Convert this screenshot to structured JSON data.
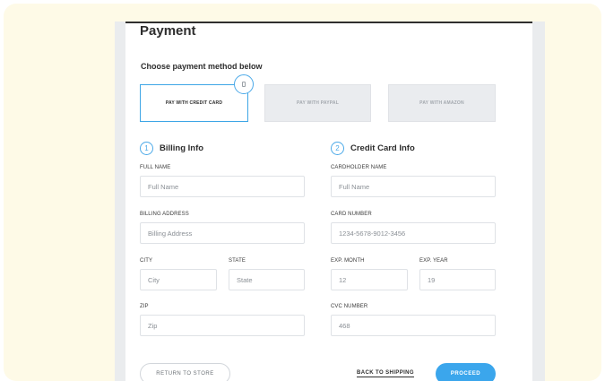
{
  "page": {
    "title": "Payment",
    "subtitle": "Choose payment method below"
  },
  "payment_methods": [
    {
      "label": "PAY WITH CREDIT CARD",
      "selected": true
    },
    {
      "label": "PAY WITH PAYPAL",
      "selected": false
    },
    {
      "label": "PAY WITH AMAZON",
      "selected": false
    }
  ],
  "billing": {
    "step": "1",
    "title": "Billing Info",
    "full_name": {
      "label": "FULL NAME",
      "placeholder": "Full Name"
    },
    "address": {
      "label": "BILLING ADDRESS",
      "placeholder": "Billing Address"
    },
    "city": {
      "label": "CITY",
      "placeholder": "City"
    },
    "state": {
      "label": "STATE",
      "placeholder": "State"
    },
    "zip": {
      "label": "ZIP",
      "placeholder": "Zip"
    }
  },
  "card": {
    "step": "2",
    "title": "Credit Card Info",
    "holder": {
      "label": "CARDHOLDER NAME",
      "placeholder": "Full Name"
    },
    "number": {
      "label": "CARD NUMBER",
      "value": "1234-5678-9012-3456"
    },
    "exp_month": {
      "label": "EXP. MONTH",
      "value": "12"
    },
    "exp_year": {
      "label": "EXP. YEAR",
      "value": "19"
    },
    "cvc": {
      "label": "CVC NUMBER",
      "value": "468"
    }
  },
  "footer": {
    "return_label": "RETURN TO STORE",
    "back_label": "BACK TO SHIPPING",
    "proceed_label": "PROCEED"
  },
  "colors": {
    "accent": "#3ba6ec",
    "background": "#fefae7"
  },
  "icons": {
    "selected_method": "card-icon"
  }
}
